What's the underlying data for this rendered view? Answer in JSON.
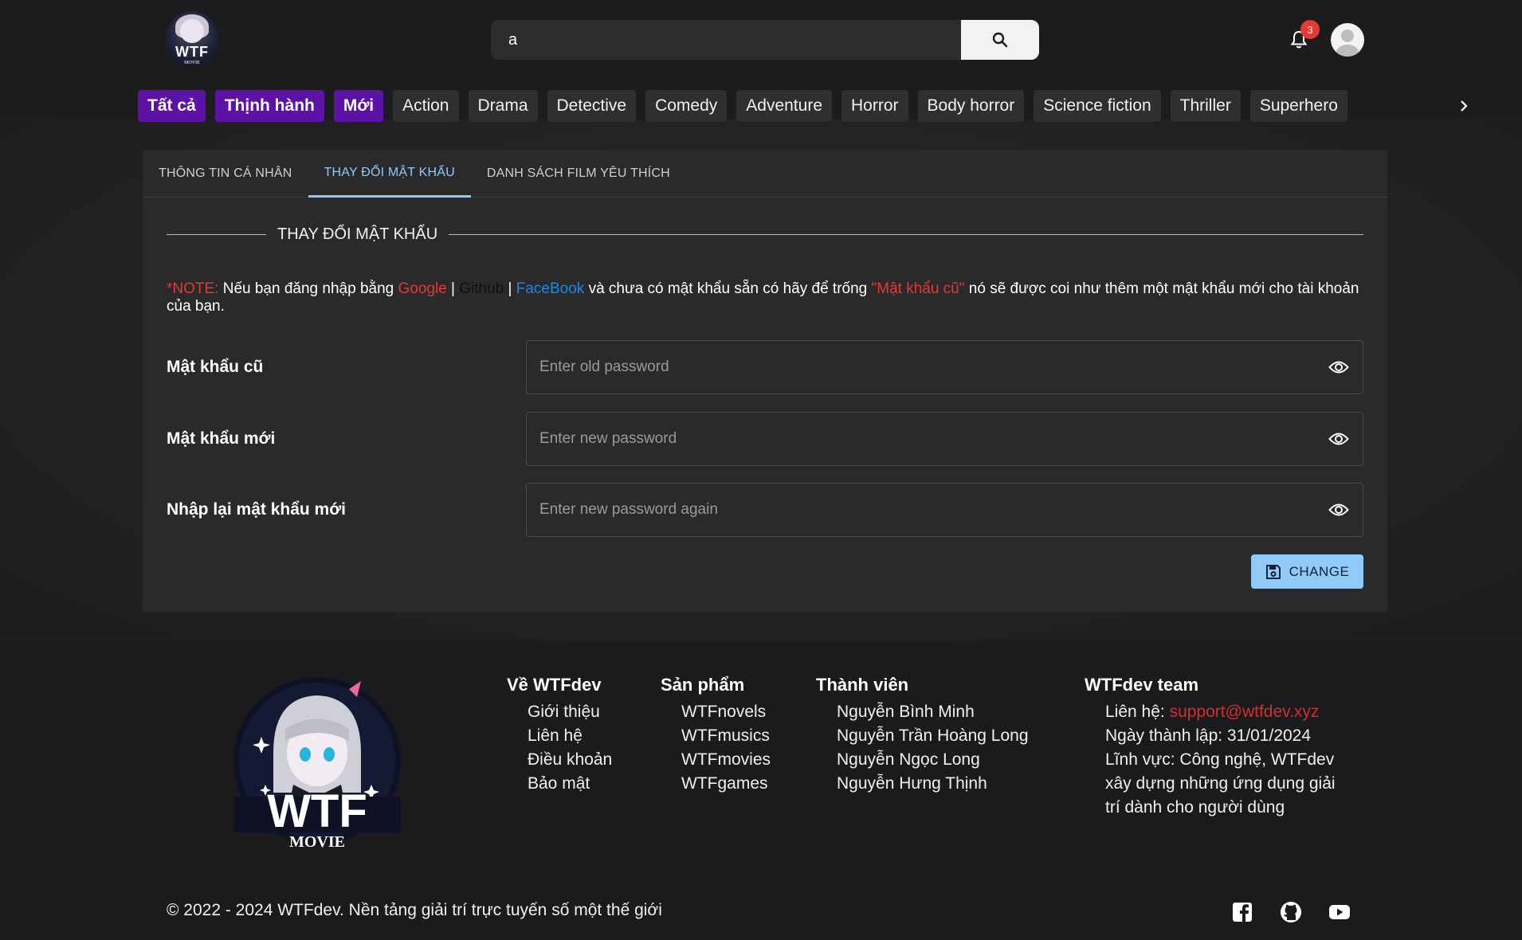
{
  "header": {
    "logo_text": "WTF",
    "logo_sub": "MOVIE",
    "search_value": "a",
    "notification_count": "3"
  },
  "genres": [
    "Tất cả",
    "Thịnh hành",
    "Mới",
    "Action",
    "Drama",
    "Detective",
    "Comedy",
    "Adventure",
    "Horror",
    "Body horror",
    "Science fiction",
    "Thriller",
    "Superhero"
  ],
  "tabs": [
    {
      "label": "THÔNG TIN CÁ NHÂN"
    },
    {
      "label": "THAY ĐỔI MẬT KHẨU"
    },
    {
      "label": "DANH SÁCH FILM YÊU THÍCH"
    }
  ],
  "section_title": "THAY ĐỔI MẬT KHẨU",
  "note": {
    "prefix": "*NOTE:",
    "text1": " Nếu bạn đăng nhập bằng ",
    "google": "Google",
    "sep": " | ",
    "github": "Github",
    "facebook": "FaceBook",
    "text2": " và chưa có mật khẩu sẵn có hãy để trống ",
    "old_pw_quote": "\"Mật khẩu cũ\"",
    "text3": " nó sẽ được coi như thêm một mật khẩu mới cho tài khoản của bạn."
  },
  "fields": [
    {
      "label": "Mật khẩu cũ",
      "placeholder": "Enter old password"
    },
    {
      "label": "Mật khẩu mới",
      "placeholder": "Enter new password"
    },
    {
      "label": "Nhập lại mật khẩu mới",
      "placeholder": "Enter new password again"
    }
  ],
  "change_button": "CHANGE",
  "footer": {
    "logo_text": "WTF",
    "logo_sub": "MOVIE",
    "about": {
      "title": "Về WTFdev",
      "items": [
        "Giới thiệu",
        "Liên hệ",
        "Điều khoản",
        "Bảo mật"
      ]
    },
    "products": {
      "title": "Sản phẩm",
      "items": [
        "WTFnovels",
        "WTFmusics",
        "WTFmovies",
        "WTFgames"
      ]
    },
    "members": {
      "title": "Thành viên",
      "items": [
        "Nguyễn Bình Minh",
        "Nguyễn Trần Hoàng Long",
        "Nguyễn Ngọc Long",
        "Nguyễn Hưng Thịnh"
      ]
    },
    "team": {
      "title": "WTFdev team",
      "contact_label": "Liên hệ: ",
      "contact_email": "support@wtfdev.xyz",
      "founded": "Ngày thành lập: 31/01/2024",
      "field_line1": "Lĩnh vực: Công nghệ, WTFdev",
      "field_line2": "xây dựng những ứng dụng giải",
      "field_line3": "trí dành cho người dùng"
    },
    "copyright": "© 2022 - 2024 WTFdev. Nền tảng giải trí trực tuyến số một thế giới"
  },
  "colors": {
    "accent": "#90caf9",
    "chip_purple": "#5d12a6",
    "note_red": "#e53935",
    "link_blue": "#1e88e5"
  }
}
